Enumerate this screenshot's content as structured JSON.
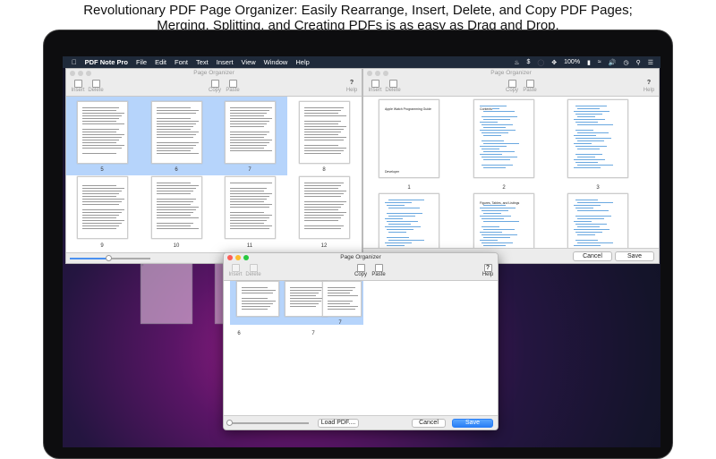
{
  "headline": {
    "line1": "Revolutionary PDF Page Organizer:  Easily Rearrange, Insert, Delete, and Copy PDF Pages;",
    "line2": "Merging, Splitting, and Creating PDFs is as easy as Drag and Drop."
  },
  "menubar": {
    "app": "PDF Note Pro",
    "items": [
      "File",
      "Edit",
      "Font",
      "Text",
      "Insert",
      "View",
      "Window",
      "Help"
    ],
    "battery": "100%",
    "icons": [
      "apple-icon",
      "flame-icon",
      "dollar-icon",
      "circle-icon",
      "move-icon",
      "battery-icon",
      "wifi-icon",
      "volume-icon",
      "clock-icon",
      "search-icon",
      "list-icon"
    ]
  },
  "window_title": "Page Organizer",
  "toolbar": {
    "insert": "Insert",
    "delete": "Delete",
    "copy": "Copy",
    "paste": "Paste",
    "help": "Help",
    "help_glyph": "?"
  },
  "left_window": {
    "row1": [
      "5",
      "6",
      "7",
      "8"
    ],
    "row2": [
      "9",
      "10",
      "11",
      "12"
    ],
    "selected": [
      "5",
      "6",
      "7"
    ],
    "zoom_fraction": 0.5
  },
  "right_window": {
    "row1": [
      "1",
      "2",
      "3"
    ],
    "page1_title": "Apple Watch Programming Guide",
    "page1_footer": "Developer",
    "page2_title": "Contents",
    "page5_title": "Figures, Tables, and Listings",
    "cancel": "Cancel",
    "save": "Save"
  },
  "front_window": {
    "pages": [
      "6",
      "7"
    ],
    "drag_label": "7",
    "load_pdf": "Load PDF....",
    "cancel": "Cancel",
    "save": "Save",
    "zoom_fraction": 0.0
  }
}
